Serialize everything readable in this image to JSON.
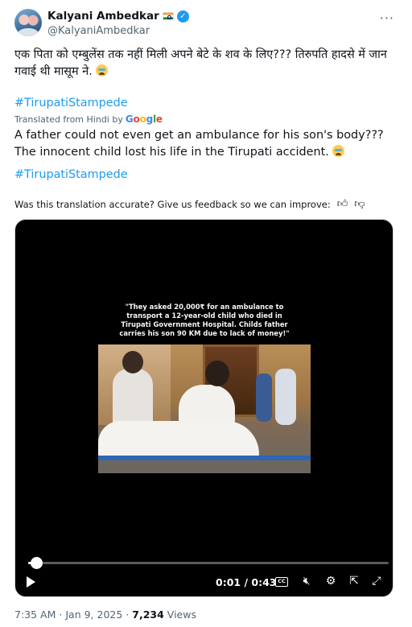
{
  "author": {
    "display_name": "Kalyani Ambedkar",
    "handle": "@KalyaniAmbedkar",
    "flag_icon": "india-flag-icon",
    "verified_icon": "verified-badge-icon"
  },
  "menu": {
    "more_label": "···"
  },
  "post": {
    "original_text": "एक पिता को एम्बुलेंस तक नहीं मिली अपने बेटे के शव के लिए??? तिरुपति हादसे में जान गवाई थी मासूम ने.",
    "hashtag": "#TirupatiStampede",
    "translated_from": "Translated from Hindi by",
    "google": "Google",
    "translated_text": "A father could not even get an ambulance for his son's body??? The innocent child lost his life in the Tirupati accident.",
    "hashtag_translated": "#TirupatiStampede"
  },
  "feedback": {
    "prompt": "Was this translation accurate? Give us feedback so we can improve:",
    "thumbs_up_icon": "thumbs-up-icon",
    "thumbs_down_icon": "thumbs-down-icon"
  },
  "video": {
    "caption": "\"They asked 20,000₹ for an ambulance to transport a 12-year-old child who died in Tirupati Government Hospital. Childs father carries his son 90 KM due to lack of money!\"",
    "current_time": "0:01",
    "time_separator": "/",
    "duration": "0:43",
    "progress": 0.023,
    "cc_label": "CC"
  },
  "meta": {
    "time": "7:35 AM",
    "separator": "·",
    "date": "Jan 9, 2025",
    "views_count": "7,234",
    "views_label": "Views"
  },
  "colors": {
    "link": "#1d9bf0",
    "secondary_text": "#536471",
    "primary_text": "#0f1419"
  }
}
